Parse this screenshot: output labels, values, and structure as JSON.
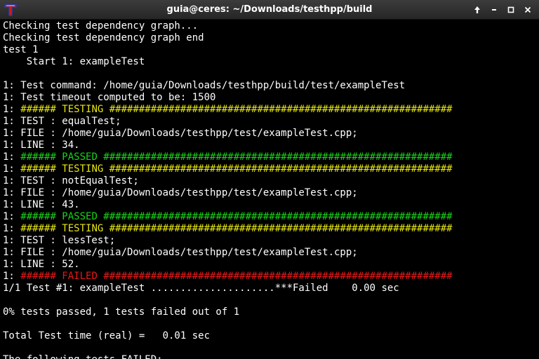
{
  "window": {
    "title": "guia@ceres: ~/Downloads/testhpp/build",
    "app_icon": "terminal-t-icon",
    "controls": [
      "pin-up-icon",
      "minimize-icon",
      "maximize-icon",
      "close-icon"
    ]
  },
  "colors": {
    "background": "#000000",
    "text": "#ffffff",
    "testing": "#e5e510",
    "passed": "#18d218",
    "failed": "#e51818"
  },
  "terminal": {
    "lines": [
      [
        {
          "t": "Checking test dependency graph..."
        }
      ],
      [
        {
          "t": "Checking test dependency graph end"
        }
      ],
      [
        {
          "t": "test 1"
        }
      ],
      [
        {
          "t": "    Start 1: exampleTest"
        }
      ],
      [
        {
          "t": ""
        }
      ],
      [
        {
          "t": "1: Test command: /home/guia/Downloads/testhpp/build/test/exampleTest"
        }
      ],
      [
        {
          "t": "1: Test timeout computed to be: 1500"
        }
      ],
      [
        {
          "t": "1: "
        },
        {
          "t": "###### TESTING ##########################################################",
          "c": "yellow"
        }
      ],
      [
        {
          "t": "1: TEST : equalTest;"
        }
      ],
      [
        {
          "t": "1: FILE : /home/guia/Downloads/testhpp/test/exampleTest.cpp;"
        }
      ],
      [
        {
          "t": "1: LINE : 34."
        }
      ],
      [
        {
          "t": "1: "
        },
        {
          "t": "###### PASSED ###########################################################",
          "c": "green"
        }
      ],
      [
        {
          "t": "1: "
        },
        {
          "t": "###### TESTING ##########################################################",
          "c": "yellow"
        }
      ],
      [
        {
          "t": "1: TEST : notEqualTest;"
        }
      ],
      [
        {
          "t": "1: FILE : /home/guia/Downloads/testhpp/test/exampleTest.cpp;"
        }
      ],
      [
        {
          "t": "1: LINE : 43."
        }
      ],
      [
        {
          "t": "1: "
        },
        {
          "t": "###### PASSED ###########################################################",
          "c": "green"
        }
      ],
      [
        {
          "t": "1: "
        },
        {
          "t": "###### TESTING ##########################################################",
          "c": "yellow"
        }
      ],
      [
        {
          "t": "1: TEST : lessTest;"
        }
      ],
      [
        {
          "t": "1: FILE : /home/guia/Downloads/testhpp/test/exampleTest.cpp;"
        }
      ],
      [
        {
          "t": "1: LINE : 52."
        }
      ],
      [
        {
          "t": "1: "
        },
        {
          "t": "###### FAILED ###########################################################",
          "c": "red"
        }
      ],
      [
        {
          "t": "1/1 Test #1: exampleTest .....................***Failed    0.00 sec"
        }
      ],
      [
        {
          "t": ""
        }
      ],
      [
        {
          "t": "0% tests passed, 1 tests failed out of 1"
        }
      ],
      [
        {
          "t": ""
        }
      ],
      [
        {
          "t": "Total Test time (real) =   0.01 sec"
        }
      ],
      [
        {
          "t": ""
        }
      ],
      [
        {
          "t": "The following tests FAILED:"
        }
      ]
    ]
  }
}
